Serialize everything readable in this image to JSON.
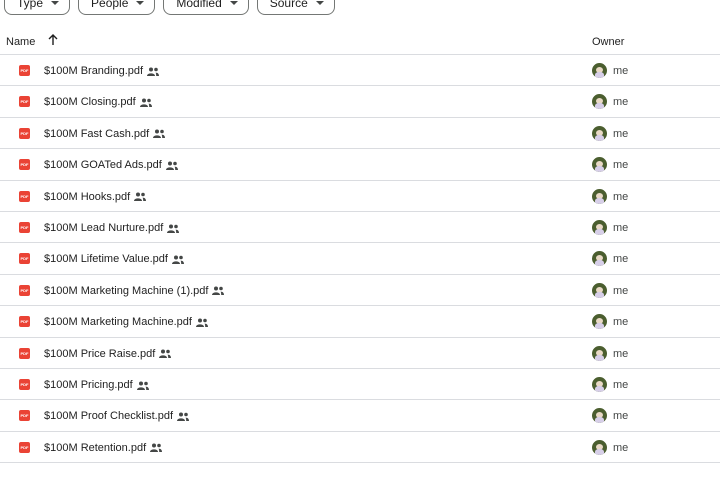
{
  "filters": [
    {
      "label": "Type"
    },
    {
      "label": "People"
    },
    {
      "label": "Modified"
    },
    {
      "label": "Source"
    }
  ],
  "header": {
    "name": "Name",
    "owner": "Owner"
  },
  "files": [
    {
      "name": "$100M Branding.pdf",
      "owner": "me"
    },
    {
      "name": "$100M Closing.pdf",
      "owner": "me"
    },
    {
      "name": "$100M Fast Cash.pdf",
      "owner": "me"
    },
    {
      "name": "$100M GOATed Ads.pdf",
      "owner": "me"
    },
    {
      "name": "$100M Hooks.pdf",
      "owner": "me"
    },
    {
      "name": "$100M Lead Nurture.pdf",
      "owner": "me"
    },
    {
      "name": "$100M Lifetime Value.pdf",
      "owner": "me"
    },
    {
      "name": "$100M Marketing Machine (1).pdf",
      "owner": "me"
    },
    {
      "name": "$100M Marketing Machine.pdf",
      "owner": "me"
    },
    {
      "name": "$100M Price Raise.pdf",
      "owner": "me"
    },
    {
      "name": "$100M Pricing.pdf",
      "owner": "me"
    },
    {
      "name": "$100M Proof Checklist.pdf",
      "owner": "me"
    },
    {
      "name": "$100M Retention.pdf",
      "owner": "me"
    }
  ],
  "icons": {
    "file_type": "pdf-icon",
    "shared": "shared-people-icon",
    "sort": "sort-ascending-arrow-icon"
  }
}
